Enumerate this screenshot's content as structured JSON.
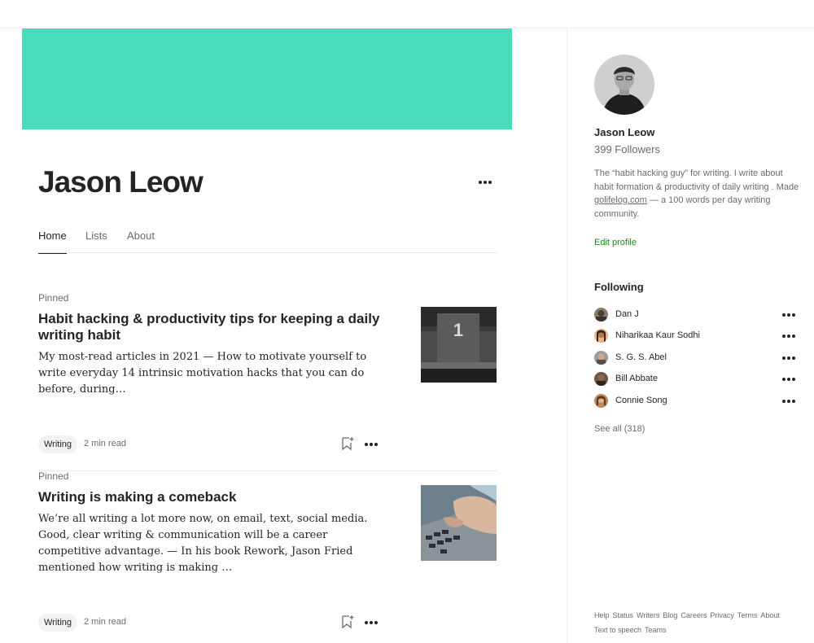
{
  "brand": {
    "banner_color": "#47dcbb",
    "accent_green": "#1a8917"
  },
  "profile": {
    "name": "Jason Leow",
    "tabs": [
      {
        "label": "Home",
        "active": true
      },
      {
        "label": "Lists",
        "active": false
      },
      {
        "label": "About",
        "active": false
      }
    ],
    "header_more_icon": "more-horizontal-icon"
  },
  "articles": [
    {
      "pinned_label": "Pinned",
      "title": "Habit hacking & productivity tips for keeping a daily writing habit",
      "excerpt": "My most-read articles in 2021 — How to motivate yourself to write everyday 14 intrinsic motivation hacks that you can do before, during…",
      "tag": "Writing",
      "read_time": "2 min read",
      "thumbnail": "podium-number-one-image"
    },
    {
      "pinned_label": "Pinned",
      "title": "Writing is making a comeback",
      "excerpt": "We’re all writing a lot more now, on email, text, social media. Good, clear writing & communication will be a career competitive advantage. — In his book Rework, Jason Fried mentioned how writing is making …",
      "tag": "Writing",
      "read_time": "2 min read",
      "thumbnail": "hands-typing-laptop-image"
    }
  ],
  "sidebar": {
    "name": "Jason Leow",
    "followers": "399 Followers",
    "bio_before": "The “habit hacking guy” for writing. I write about habit formation & productivity of daily writing . Made ",
    "bio_link": "golifelog.com",
    "bio_after": " — a 100 words per day writing community.",
    "edit_profile": "Edit profile",
    "following_title": "Following",
    "following": [
      {
        "name": "Dan J"
      },
      {
        "name": "Niharikaa Kaur Sodhi"
      },
      {
        "name": "S. G. S. Abel"
      },
      {
        "name": "Bill Abbate"
      },
      {
        "name": "Connie Song"
      }
    ],
    "see_all": "See all (318)",
    "footer_links": [
      "Help",
      "Status",
      "Writers",
      "Blog",
      "Careers",
      "Privacy",
      "Terms",
      "About",
      "Text to speech",
      "Teams"
    ]
  }
}
